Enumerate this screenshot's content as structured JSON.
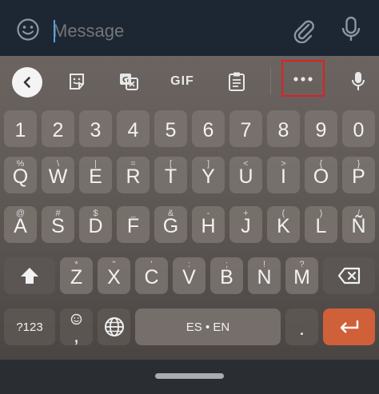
{
  "composer": {
    "placeholder": "Message"
  },
  "toolbar": {
    "gif_label": "GIF"
  },
  "rows": {
    "numbers": [
      "1",
      "2",
      "3",
      "4",
      "5",
      "6",
      "7",
      "8",
      "9",
      "0"
    ],
    "row1": [
      {
        "hint": "%",
        "key": "Q"
      },
      {
        "hint": "\\",
        "key": "W"
      },
      {
        "hint": "|",
        "key": "E"
      },
      {
        "hint": "=",
        "key": "R"
      },
      {
        "hint": "[",
        "key": "T"
      },
      {
        "hint": "]",
        "key": "Y"
      },
      {
        "hint": "<",
        "key": "U"
      },
      {
        "hint": ">",
        "key": "I"
      },
      {
        "hint": "{",
        "key": "O"
      },
      {
        "hint": "}",
        "key": "P"
      }
    ],
    "row2": [
      {
        "hint": "@",
        "key": "A"
      },
      {
        "hint": "#",
        "key": "S"
      },
      {
        "hint": "$",
        "key": "D"
      },
      {
        "hint": "_",
        "key": "F"
      },
      {
        "hint": "&",
        "key": "G"
      },
      {
        "hint": "-",
        "key": "H"
      },
      {
        "hint": "+",
        "key": "J"
      },
      {
        "hint": "(",
        "key": "K"
      },
      {
        "hint": ")",
        "key": "L"
      },
      {
        "hint": "/",
        "key": "Ñ"
      }
    ],
    "row3": [
      {
        "hint": "*",
        "key": "Z"
      },
      {
        "hint": "\"",
        "key": "X"
      },
      {
        "hint": "'",
        "key": "C"
      },
      {
        "hint": ":",
        "key": "V"
      },
      {
        "hint": ";",
        "key": "B"
      },
      {
        "hint": "!",
        "key": "N"
      },
      {
        "hint": "?",
        "key": "M"
      }
    ]
  },
  "bottom": {
    "symbols_label": "?123",
    "comma": ",",
    "space_label": "ES • EN",
    "period": "."
  },
  "colors": {
    "topbar": "#1c2733",
    "enter_key": "#d0603a",
    "highlight": "#e02020"
  }
}
